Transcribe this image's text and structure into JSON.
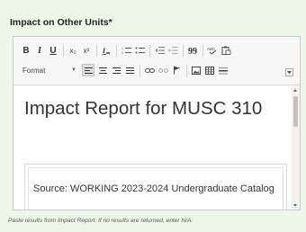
{
  "field": {
    "label": "Impact on Other Units*",
    "hint": "Paste results from Impact Report. If no results are returned, enter N/A."
  },
  "toolbar": {
    "bold": "B",
    "italic": "I",
    "underline": "U",
    "subscript": "x₂",
    "superscript": "x²",
    "remove_format": "Ix",
    "format_select": "Format"
  },
  "content": {
    "title": "Impact Report for MUSC 310",
    "source": "Source: WORKING 2023-2024 Undergraduate Catalog"
  },
  "colors": {
    "background": "#eef6e7",
    "editor_border": "#c9c9c9",
    "toolbar_bg": "#f7f7f7"
  }
}
